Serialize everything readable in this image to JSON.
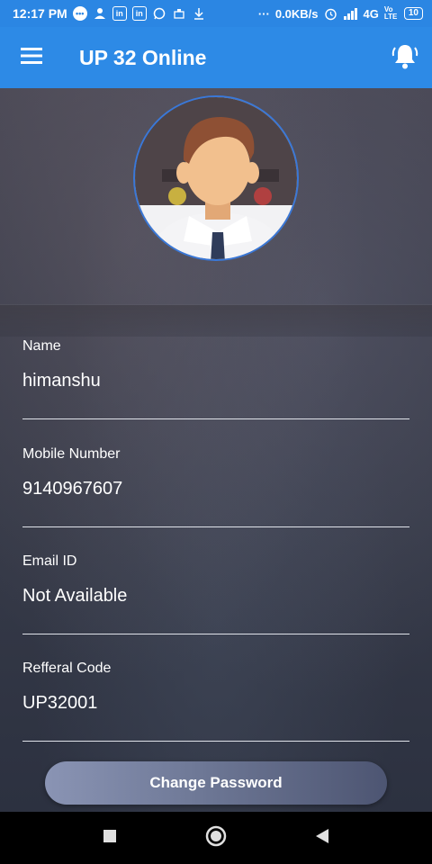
{
  "status_bar": {
    "time": "12:17 PM",
    "net_speed": "0.0KB/s",
    "network": "4G",
    "volte": "Vo LTE",
    "battery": "10",
    "icons": [
      "messenger-icon",
      "person-icon",
      "linkedin-icon",
      "linkedin-icon",
      "whatsapp-icon",
      "usb-icon",
      "download-icon",
      "more-icon",
      "alarm-icon",
      "signal-icon"
    ]
  },
  "app_bar": {
    "title": "UP 32 Online",
    "menu_icon": "hamburger-menu-icon",
    "notification_icon": "bell-icon"
  },
  "profile": {
    "fields": [
      {
        "label": "Name",
        "value": "himanshu"
      },
      {
        "label": "Mobile Number",
        "value": "9140967607"
      },
      {
        "label": "Email ID",
        "value": "Not Available"
      },
      {
        "label": "Refferal Code",
        "value": "UP32001"
      }
    ],
    "change_password_label": "Change Password"
  },
  "colors": {
    "app_bar": "#2d8ae6",
    "status_bar": "#2b86e3",
    "avatar_border": "#3a78d8",
    "field_underline": "#e0e3ea",
    "nav_bar": "#000000"
  },
  "nav_bar": {
    "icons": [
      "recents-square-icon",
      "home-circle-icon",
      "back-triangle-icon"
    ]
  }
}
